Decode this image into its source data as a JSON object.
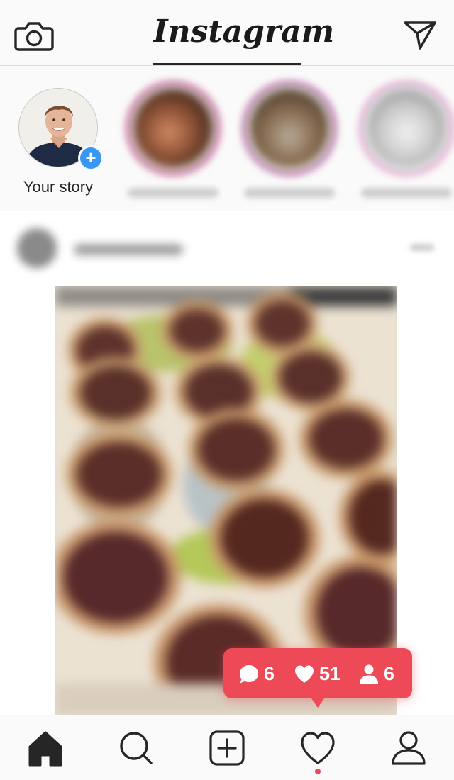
{
  "header": {
    "logo": "Instagram",
    "camera_icon": "camera-icon",
    "direct_icon": "paper-plane-icon"
  },
  "stories": {
    "own": {
      "label": "Your story",
      "add_icon": "plus-icon"
    },
    "others": [
      {
        "avatar": "blurred-avatar"
      },
      {
        "avatar": "blurred-avatar"
      },
      {
        "avatar": "blurred-avatar"
      }
    ]
  },
  "post": {
    "image": "blurred-photo-of-chocolate-tarts"
  },
  "activity_bubble": {
    "comments": "6",
    "likes": "51",
    "follows": "6",
    "color": "#ed4956"
  },
  "bottom_nav": {
    "items": [
      "home-icon",
      "search-icon",
      "add-post-icon",
      "heart-icon",
      "profile-icon"
    ],
    "active": "home-icon",
    "notification_dot_color": "#ed4956"
  },
  "colors": {
    "accent_blue": "#3897f0",
    "background": "#fafafa",
    "divider": "#dbdbdb"
  }
}
